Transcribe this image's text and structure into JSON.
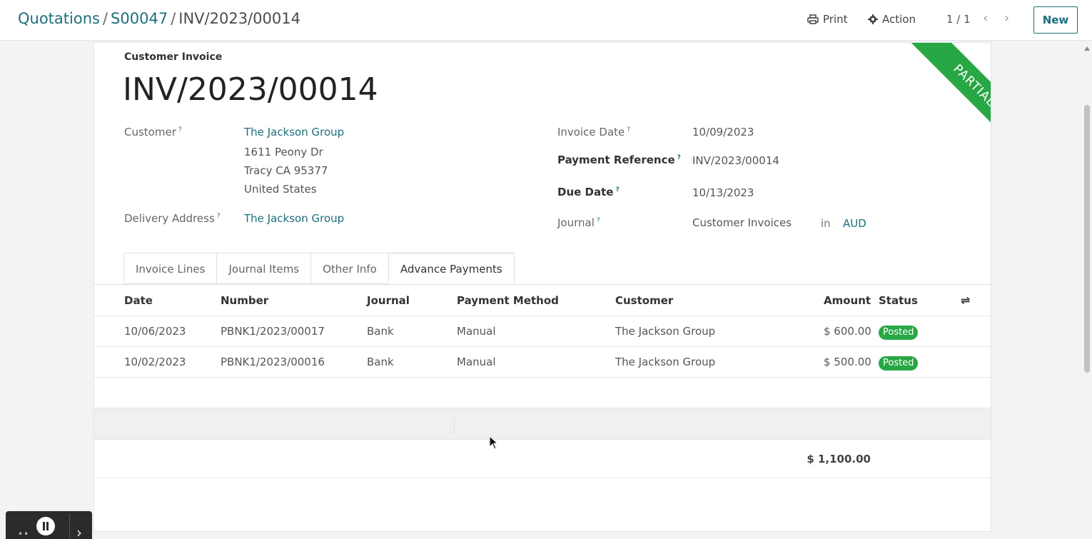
{
  "breadcrumb": {
    "items": [
      "Quotations",
      "S00047"
    ],
    "current": "INV/2023/00014",
    "separator": "/"
  },
  "toolbar": {
    "print_label": "Print",
    "action_label": "Action",
    "pager": "1 / 1",
    "prev_icon": "chevron-left-icon",
    "next_icon": "chevron-right-icon",
    "new_label": "New"
  },
  "invoice": {
    "doc_type": "Customer Invoice",
    "number": "INV/2023/00014",
    "status_ribbon": "PARTIAL",
    "help_mark": "?",
    "fields": {
      "customer_label": "Customer",
      "customer_name": "The Jackson Group",
      "address": [
        "1611 Peony Dr",
        "Tracy CA 95377",
        "United States"
      ],
      "delivery_label": "Delivery Address",
      "delivery_value": "The Jackson Group",
      "invoice_date_label": "Invoice Date",
      "invoice_date": "10/09/2023",
      "payment_ref_label": "Payment Reference",
      "payment_ref": "INV/2023/00014",
      "due_date_label": "Due Date",
      "due_date": "10/13/2023",
      "journal_label": "Journal",
      "journal_value": "Customer Invoices",
      "in_label": "in",
      "currency": "AUD"
    }
  },
  "tabs": [
    {
      "label": "Invoice Lines",
      "active": false
    },
    {
      "label": "Journal Items",
      "active": false
    },
    {
      "label": "Other Info",
      "active": false
    },
    {
      "label": "Advance Payments",
      "active": true
    }
  ],
  "payments": {
    "headers": [
      "Date",
      "Number",
      "Journal",
      "Payment Method",
      "Customer",
      "Amount",
      "Status"
    ],
    "rows": [
      [
        "10/06/2023",
        "PBNK1/2023/00017",
        "Bank",
        "Manual",
        "The Jackson Group",
        "$ 600.00",
        "Posted"
      ],
      [
        "10/02/2023",
        "PBNK1/2023/00016",
        "Bank",
        "Manual",
        "The Jackson Group",
        "$ 500.00",
        "Posted"
      ]
    ],
    "total": "$ 1,100.00",
    "options_icon": "sliders-icon"
  },
  "colors": {
    "accent": "#1d6f7d",
    "posted": "#28a745",
    "ribbon": "#28a745"
  }
}
